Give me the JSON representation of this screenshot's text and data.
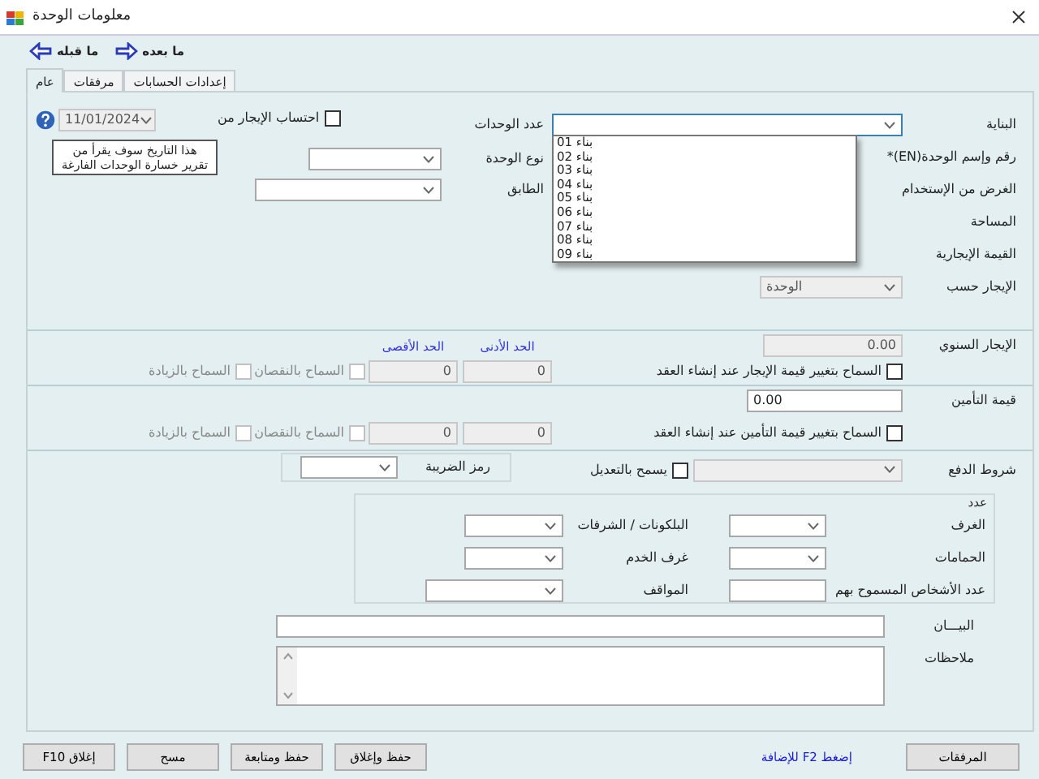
{
  "window": {
    "title": "معلومات الوحدة"
  },
  "toolbar": [
    {
      "kind": "next",
      "label": "ما بعده"
    },
    {
      "kind": "previous",
      "label": "ما قبله"
    }
  ],
  "tabs": [
    {
      "label": "إعدادات الحسابات",
      "selected": false
    },
    {
      "label": "مرفقات",
      "selected": false
    },
    {
      "label": "عام",
      "selected": true
    }
  ],
  "unit": {
    "building": {
      "label": "البناية",
      "expanded": true,
      "options": [
        "بناء 01",
        "بناء 02",
        "بناء 03",
        "بناء 04",
        "بناء 05",
        "بناء 06",
        "بناء 07",
        "بناء 08",
        "بناء 09"
      ]
    },
    "labels": [
      "رقم وإسم الوحدة(EN)*",
      "الغرض من الإستخدام",
      "المساحة",
      "القيمة الإيجارية"
    ],
    "rent_by": {
      "label": "الإيجار حسب",
      "value": "الوحدة",
      "disabled": true
    },
    "units_count_label": "عدد الوحدات",
    "unit_type": {
      "label": "نوع الوحدة"
    },
    "floor": {
      "label": "الطابق"
    },
    "rent_from": {
      "label": "احتساب الإيجار من",
      "checked": false
    },
    "date": {
      "value": "11/01/2024",
      "disabled": true
    },
    "note": "هذا التاريخ سوف يقرأ من تقرير خسارة الوحدات الفارغة"
  },
  "annual_rent": {
    "label": "الإيجار السنوي",
    "value": "0.00",
    "disabled": true,
    "allow_change": {
      "label": "السماح بتغيير قيمة الإيجار عند إنشاء العقد",
      "checked": false
    },
    "min_header": "الحد الأدنى",
    "max_header": "الحد الأقصى",
    "min": {
      "value": "0",
      "disabled": true
    },
    "max": {
      "value": "0",
      "disabled": true
    },
    "allow_decrease": {
      "label": "السماح بالنقصان",
      "checked": false,
      "disabled": true
    },
    "allow_increase": {
      "label": "السماح بالزيادة",
      "checked": false,
      "disabled": true
    }
  },
  "deposit": {
    "label": "قيمة التأمين",
    "value": "0.00",
    "disabled": false,
    "allow_change": {
      "label": "السماح بتغيير قيمة التأمين عند إنشاء العقد",
      "checked": false
    },
    "min": {
      "value": "0",
      "disabled": true
    },
    "max": {
      "value": "0",
      "disabled": true
    },
    "allow_decrease": {
      "label": "السماح بالنقصان",
      "checked": false,
      "disabled": true
    },
    "allow_increase": {
      "label": "السماح بالزيادة",
      "checked": false,
      "disabled": true
    }
  },
  "payment_terms": {
    "label": "شروط الدفع",
    "disabled": true,
    "allow_edit": {
      "label": "يسمح بالتعديل",
      "checked": false
    }
  },
  "tax_code": {
    "label": "رمز الضريبة"
  },
  "counts": {
    "title": "عدد",
    "fields": [
      {
        "kind": "select",
        "label": "الغرف"
      },
      {
        "kind": "select",
        "label": "البلكونات / الشرفات"
      },
      {
        "kind": "select",
        "label": "الحمامات"
      },
      {
        "kind": "select",
        "label": "غرف الخدم"
      },
      {
        "kind": "input",
        "label": "عدد الأشخاص المسموح بهم"
      },
      {
        "kind": "select",
        "label": "المواقف"
      }
    ]
  },
  "description_label": "البيـــان",
  "notes_label": "ملاحظات",
  "footer": {
    "attachments": "المرفقات",
    "hint": "إضغط F2 للإضافة",
    "buttons": [
      "حفظ وإغلاق",
      "حفظ ومتابعة",
      "مسح",
      "إغلاق F10"
    ]
  }
}
